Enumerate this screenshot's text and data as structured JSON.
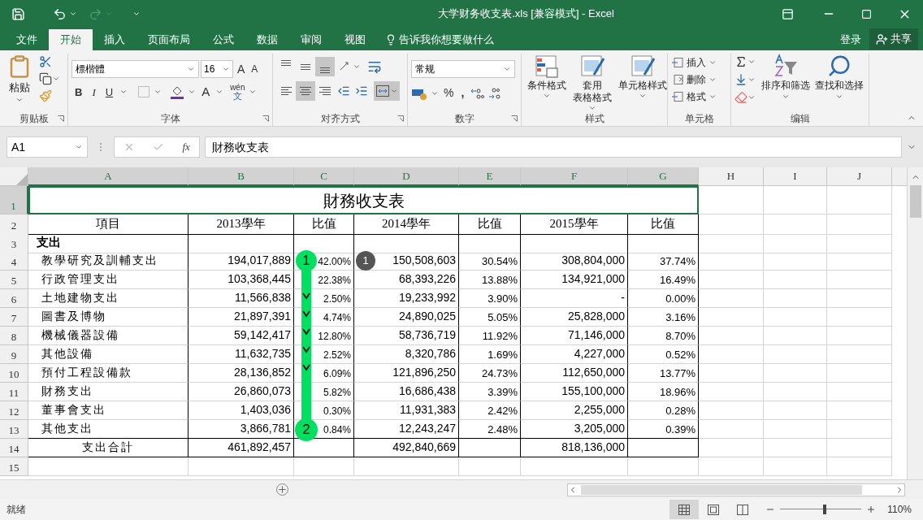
{
  "window": {
    "title": "大学财务收支表.xls  [兼容模式] - Excel"
  },
  "tabs": [
    {
      "label": "文件",
      "selected": false
    },
    {
      "label": "开始",
      "selected": true
    },
    {
      "label": "插入",
      "selected": false
    },
    {
      "label": "页面布局",
      "selected": false
    },
    {
      "label": "公式",
      "selected": false
    },
    {
      "label": "数据",
      "selected": false
    },
    {
      "label": "审阅",
      "selected": false
    },
    {
      "label": "视图",
      "selected": false
    }
  ],
  "tell_me": "告诉我你想要做什么",
  "sign_in": "登录",
  "share": "共享",
  "clipboard": {
    "paste": "粘贴",
    "label": "剪贴板"
  },
  "font": {
    "name": "標楷體",
    "size": "16",
    "grow": "A",
    "shrink": "A",
    "bold": "B",
    "italic": "I",
    "underline": "U",
    "font_color": "A",
    "phonetic_top": "wén",
    "phonetic_bottom": "文",
    "label": "字体"
  },
  "alignment": {
    "label": "对齐方式",
    "top_row": [
      {
        "kind": "top",
        "selected": false
      },
      {
        "kind": "middle",
        "selected": false
      },
      {
        "kind": "bottom",
        "selected": true
      }
    ],
    "bottom_row": [
      {
        "kind": "left",
        "selected": false
      },
      {
        "kind": "center",
        "selected": true
      },
      {
        "kind": "right",
        "selected": false
      }
    ],
    "merge_selected": true
  },
  "number": {
    "format": "常规",
    "percent": "%",
    "comma": ",",
    "label": "数字"
  },
  "styles": {
    "buttons": [
      {
        "lines": [
          "条件格式"
        ]
      },
      {
        "lines": [
          "套用",
          "表格格式"
        ]
      },
      {
        "lines": [
          "单元格样式"
        ]
      }
    ],
    "label": "样式"
  },
  "cells": {
    "buttons": [
      "插入",
      "删除",
      "格式"
    ],
    "label": "单元格"
  },
  "editing": {
    "buttons": [
      "排序和筛选",
      "查找和选择"
    ],
    "label": "编辑"
  },
  "formula_bar": {
    "name_box": "A1",
    "fx": "fx",
    "value": "財務收支表"
  },
  "columns": [
    "A",
    "B",
    "C",
    "D",
    "E",
    "F",
    "G",
    "H",
    "I",
    "J"
  ],
  "row_numbers": [
    "1",
    "2",
    "3",
    "4",
    "5",
    "6",
    "7",
    "8",
    "9",
    "10",
    "11",
    "12",
    "13",
    "14",
    "15"
  ],
  "sheet": {
    "title": "財務收支表",
    "header": [
      "項目",
      "2013學年",
      "比值",
      "2014學年",
      "比值",
      "2015學年",
      "比值"
    ],
    "section": "支出",
    "rows": [
      {
        "label": "教學研究及訓輔支出",
        "b": "194,017,889",
        "c": "42.00%",
        "d": "150,508,603",
        "e": "30.54%",
        "f": "308,804,000",
        "g": "37.74%"
      },
      {
        "label": "行政管理支出",
        "b": "103,368,445",
        "c": "22.38%",
        "d": "68,393,226",
        "e": "13.88%",
        "f": "134,921,000",
        "g": "16.49%"
      },
      {
        "label": "土地建物支出",
        "b": "11,566,838",
        "c": "2.50%",
        "d": "19,233,992",
        "e": "3.90%",
        "f": "-",
        "g": "0.00%"
      },
      {
        "label": "圖書及博物",
        "b": "21,897,391",
        "c": "4.74%",
        "d": "24,890,025",
        "e": "5.05%",
        "f": "25,828,000",
        "g": "3.16%"
      },
      {
        "label": "機械儀器設備",
        "b": "59,142,417",
        "c": "12.80%",
        "d": "58,736,719",
        "e": "11.92%",
        "f": "71,146,000",
        "g": "8.70%"
      },
      {
        "label": "其他設備",
        "b": "11,632,735",
        "c": "2.52%",
        "d": "8,320,786",
        "e": "1.69%",
        "f": "4,227,000",
        "g": "0.52%"
      },
      {
        "label": "預付工程設備款",
        "b": "28,136,852",
        "c": "6.09%",
        "d": "121,896,250",
        "e": "24.73%",
        "f": "112,650,000",
        "g": "13.77%"
      },
      {
        "label": "財務支出",
        "b": "26,860,073",
        "c": "5.82%",
        "d": "16,686,438",
        "e": "3.39%",
        "f": "155,100,000",
        "g": "18.96%"
      },
      {
        "label": "董事會支出",
        "b": "1,403,036",
        "c": "0.30%",
        "d": "11,931,383",
        "e": "2.42%",
        "f": "2,255,000",
        "g": "0.28%"
      },
      {
        "label": "其他支出",
        "b": "3,866,781",
        "c": "0.84%",
        "d": "12,243,247",
        "e": "2.48%",
        "f": "3,205,000",
        "g": "0.39%"
      }
    ],
    "total": {
      "label": "支出合計",
      "b": "461,892,457",
      "d": "492,840,669",
      "f": "818,136,000"
    }
  },
  "annotation": {
    "start": "1",
    "end": "2",
    "badge": "1"
  },
  "status_bar": {
    "text": "就绪",
    "views": [
      {
        "kind": "normal",
        "selected": true
      },
      {
        "kind": "layout",
        "selected": false
      },
      {
        "kind": "break",
        "selected": false
      }
    ],
    "zoom_slider": {
      "level": 0.55
    },
    "zoom": "110%"
  }
}
